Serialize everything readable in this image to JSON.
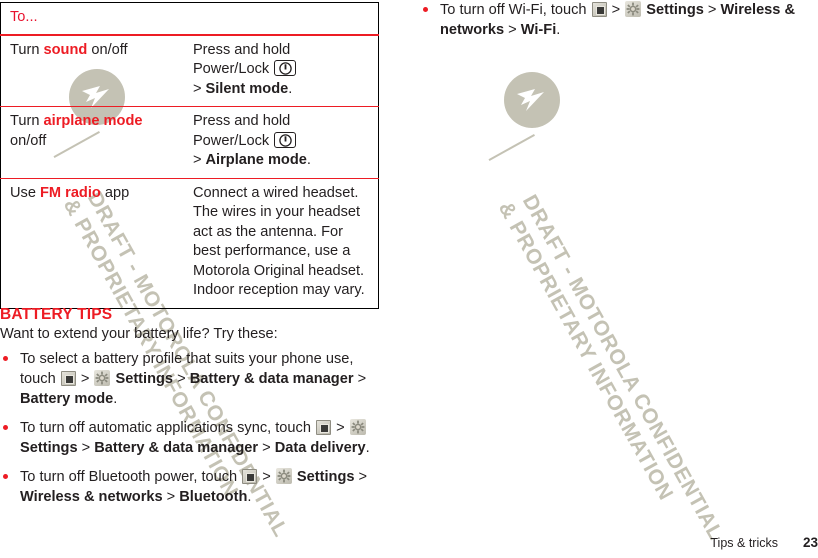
{
  "document": {
    "footer": {
      "section_label": "Tips & tricks",
      "page_number": "23"
    },
    "watermark": {
      "line1": "DRAFT - MOTOROLA CONFIDENTIAL",
      "line2": "& PROPRIETARY INFORMATION",
      "logo_name": "motorola-batwing-logo",
      "color": "#c4c2b4"
    },
    "colors": {
      "accent_red": "#ed1c24",
      "text": "#231f20",
      "rule_red": "#ed1c24"
    }
  },
  "table": {
    "header": "To...",
    "rows": [
      {
        "task_pre": "Turn ",
        "task_highlight": "sound",
        "task_post": " on/off",
        "action_line1": "Press and hold",
        "action_line2": "Power/Lock",
        "action_icon": "power-lock-icon",
        "action_line3_prefix": "> ",
        "action_line3_bold": "Silent mode",
        "action_line3_suffix": "."
      },
      {
        "task_pre": "Turn ",
        "task_highlight": "airplane mode",
        "task_post": " on/off",
        "action_line1": "Press and hold",
        "action_line2": "Power/Lock",
        "action_icon": "power-lock-icon",
        "action_line3_prefix": "> ",
        "action_line3_bold": "Airplane mode",
        "action_line3_suffix": "."
      },
      {
        "task_pre": "Use ",
        "task_highlight": "FM radio",
        "task_post": " app",
        "action_body": "Connect a wired headset. The wires in your headset act as the antenna. For best performance, use a Motorola Original headset. Indoor reception may vary."
      }
    ]
  },
  "battery_tips": {
    "heading": "BATTERY TIPS",
    "intro": "Want to extend your battery life? Try these:",
    "bullets": [
      {
        "id": "battery-profile",
        "seg1": "To select a battery profile that suits your phone use, touch ",
        "icon1": "menu-icon",
        "seg2": " > ",
        "icon2": "settings-gear-icon",
        "bold1": "Settings",
        "seg3": " > ",
        "bold2": "Battery & data manager",
        "seg4": " > ",
        "bold3": "Battery mode",
        "seg5": "."
      },
      {
        "id": "applications-sync",
        "seg1": "To turn off automatic applications sync, touch ",
        "icon1": "menu-icon",
        "seg2": " > ",
        "icon2": "settings-gear-icon",
        "bold1": "Settings",
        "seg3": " > ",
        "bold2": "Battery & data manager",
        "seg4": " > ",
        "bold3": "Data delivery",
        "seg5": "."
      },
      {
        "id": "bluetooth-power",
        "seg1": "To turn off Bluetooth power, touch ",
        "icon1": "menu-icon",
        "seg2": " > ",
        "icon2": "settings-gear-icon",
        "bold1": "Settings",
        "seg3": " > ",
        "bold2": "Wireless & networks",
        "seg4": " > ",
        "bold3": "Bluetooth",
        "seg5": "."
      },
      {
        "id": "wifi",
        "seg1": "To turn off Wi-Fi, touch ",
        "icon1": "menu-icon",
        "seg2": " > ",
        "icon2": "settings-gear-icon",
        "bold1": "Settings",
        "seg3": " > ",
        "bold2": "Wireless & networks",
        "seg4": " > ",
        "bold3": "Wi-Fi",
        "seg5": "."
      }
    ]
  }
}
